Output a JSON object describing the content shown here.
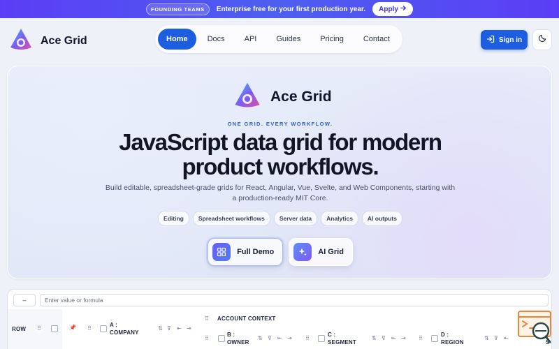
{
  "banner": {
    "tag": "FOUNDING TEAMS",
    "message": "Enterprise free for your first production year.",
    "apply_label": "Apply"
  },
  "header": {
    "brand": "Ace Grid",
    "nav": [
      "Home",
      "Docs",
      "API",
      "Guides",
      "Pricing",
      "Contact"
    ],
    "active_nav": "Home",
    "signin_label": "Sign in"
  },
  "hero": {
    "brand": "Ace Grid",
    "eyebrow": "ONE GRID. EVERY WORKFLOW.",
    "headline_line1": "JavaScript data grid for modern",
    "headline_line2": "product workflows.",
    "subtitle_line1": "Build editable, spreadsheet-grade grids for React, Angular, Vue, Svelte, and Web Components, starting with",
    "subtitle_line2": "a production-ready MIT Core.",
    "chips": [
      "Editing",
      "Spreadsheet workflows",
      "Server data",
      "Analytics",
      "AI outputs"
    ],
    "cta_primary": "Full Demo",
    "cta_secondary": "AI Grid"
  },
  "grid": {
    "cell_ref": "–",
    "formula_placeholder": "Enter value or formula",
    "row_header": "ROW",
    "group_header": "ACCOUNT CONTEXT",
    "col_a_line1": "A :",
    "col_a_line2": "COMPANY",
    "col_b_line1": "B :",
    "col_b_line2": "OWNER",
    "col_c_line1": "C :",
    "col_c_line2": "SEGMENT",
    "col_d_line1": "D :",
    "col_d_line2": "REGION",
    "col_e_partial": "S"
  },
  "colors": {
    "accent": "#1d5ee0",
    "banner": "#5b3df5",
    "brand_gradient": [
      "#7b5cf5",
      "#e04fa8",
      "#3ec3f0"
    ]
  }
}
